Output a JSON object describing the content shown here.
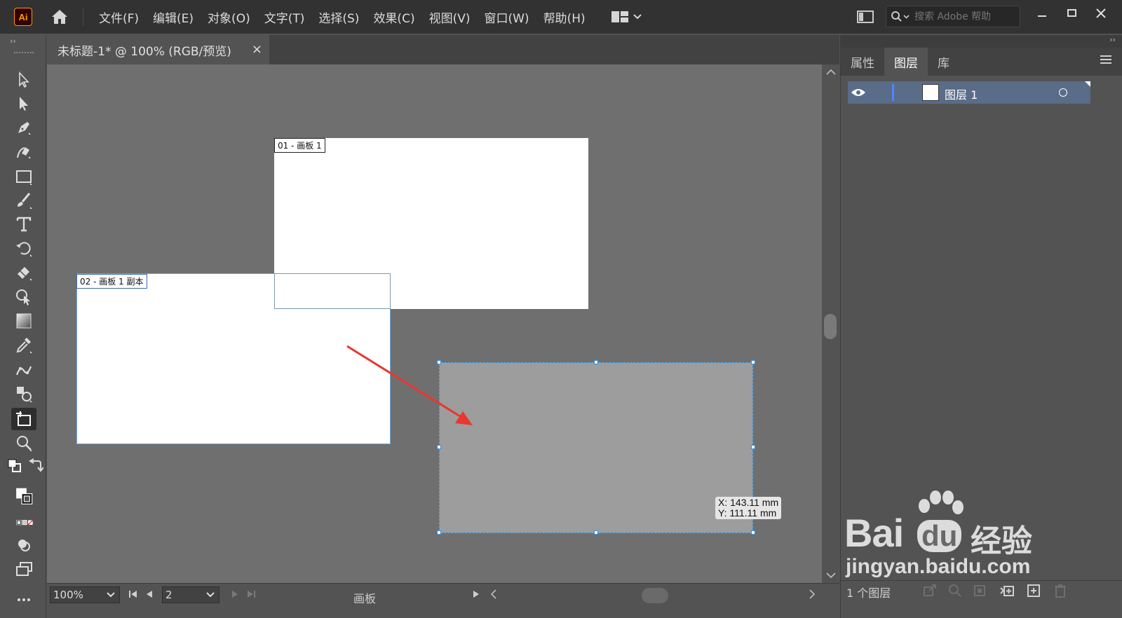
{
  "app": {
    "logo_text": "Ai",
    "menu": [
      "文件(F)",
      "编辑(E)",
      "对象(O)",
      "文字(T)",
      "选择(S)",
      "效果(C)",
      "视图(V)",
      "窗口(W)",
      "帮助(H)"
    ],
    "search_placeholder": "搜索 Adobe 帮助"
  },
  "document": {
    "tab_title": "未标题-1* @ 100% (RGB/预览)",
    "close_glyph": "×"
  },
  "toolbar": {
    "collapse_glyph": "››",
    "tools": [
      "selection-tool",
      "direct-selection-tool",
      "pen-tool",
      "curvature-tool",
      "rectangle-tool",
      "paintbrush-tool",
      "type-tool",
      "rotate-tool",
      "eraser-tool",
      "shape-builder-tool",
      "gradient-tool",
      "eyedropper-tool",
      "puppet-warp-tool",
      "blend-tool",
      "artboard-tool",
      "zoom-tool"
    ],
    "active_tool": "artboard-tool"
  },
  "canvas": {
    "artboards": [
      {
        "label": "01 - 画板 1"
      },
      {
        "label": "02 - 画板 1 副本"
      }
    ],
    "coord_tip": {
      "x": "X: 143.11 mm",
      "y": "Y: 111.11 mm"
    },
    "colors": {
      "canvas": "#6f6f6f",
      "artboard": "#ffffff",
      "new_artboard": "#9d9d9d",
      "arrow": "#e8372f",
      "selection": "#2a8fe0"
    }
  },
  "status": {
    "zoom": "100%",
    "artboard_number": "2",
    "mode_label": "画板"
  },
  "right_panel": {
    "collapse_glyph": "››",
    "tabs": [
      "属性",
      "图层",
      "库"
    ],
    "active_tab": "图层",
    "layers": [
      {
        "name": "图层 1",
        "color": "#4f85ff"
      }
    ],
    "layer_count": "1 个图层"
  },
  "watermark": {
    "brand": "Bai",
    "brand_paw": "du",
    "suffix": "经验",
    "url": "jingyan.baidu.com"
  }
}
